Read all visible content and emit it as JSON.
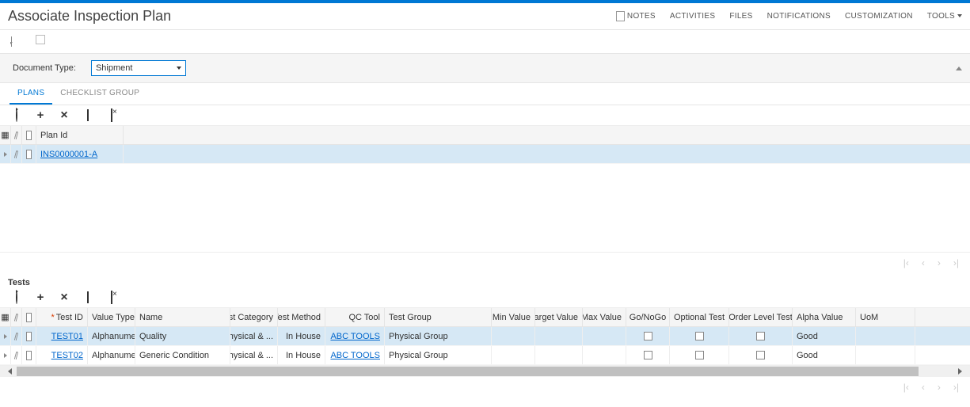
{
  "header": {
    "title": "Associate Inspection Plan",
    "nav": {
      "notes": "NOTES",
      "activities": "ACTIVITIES",
      "files": "FILES",
      "notifications": "NOTIFICATIONS",
      "customization": "CUSTOMIZATION",
      "tools": "TOOLS"
    }
  },
  "filter": {
    "doc_type_label": "Document Type:",
    "doc_type_value": "Shipment"
  },
  "tabs": {
    "plans": "PLANS",
    "checklist": "CHECKLIST GROUP"
  },
  "plans": {
    "columns": {
      "plan_id": "Plan Id"
    },
    "rows": [
      {
        "plan_id": "INS0000001-A"
      }
    ]
  },
  "tests": {
    "title": "Tests",
    "columns": {
      "test_id": "Test ID",
      "value_type": "Value Type",
      "name": "Name",
      "test_category": "Test Category",
      "test_method": "Test Method",
      "qc_tool": "QC Tool",
      "test_group": "Test Group",
      "min_value": "Min Value",
      "target_value": "Target Value",
      "max_value": "Max Value",
      "go_nogo": "Go/NoGo",
      "optional_test": "Optional Test",
      "order_level_test": "Order Level Test",
      "alpha_value": "Alpha Value",
      "uom": "UoM"
    },
    "rows": [
      {
        "test_id": "TEST01",
        "value_type": "Alphanumeric",
        "name": "Quality",
        "test_category": "Physical & ...",
        "test_method": "In House",
        "qc_tool": "ABC TOOLS",
        "test_group": "Physical Group",
        "min_value": "",
        "target_value": "",
        "max_value": "",
        "go_nogo": false,
        "optional_test": false,
        "order_level_test": false,
        "alpha_value": "Good",
        "uom": ""
      },
      {
        "test_id": "TEST02",
        "value_type": "Alphanumeric",
        "name": "Generic Condition",
        "test_category": "Physical & ...",
        "test_method": "In House",
        "qc_tool": "ABC TOOLS",
        "test_group": "Physical Group",
        "min_value": "",
        "target_value": "",
        "max_value": "",
        "go_nogo": false,
        "optional_test": false,
        "order_level_test": false,
        "alpha_value": "Good",
        "uom": ""
      }
    ]
  }
}
